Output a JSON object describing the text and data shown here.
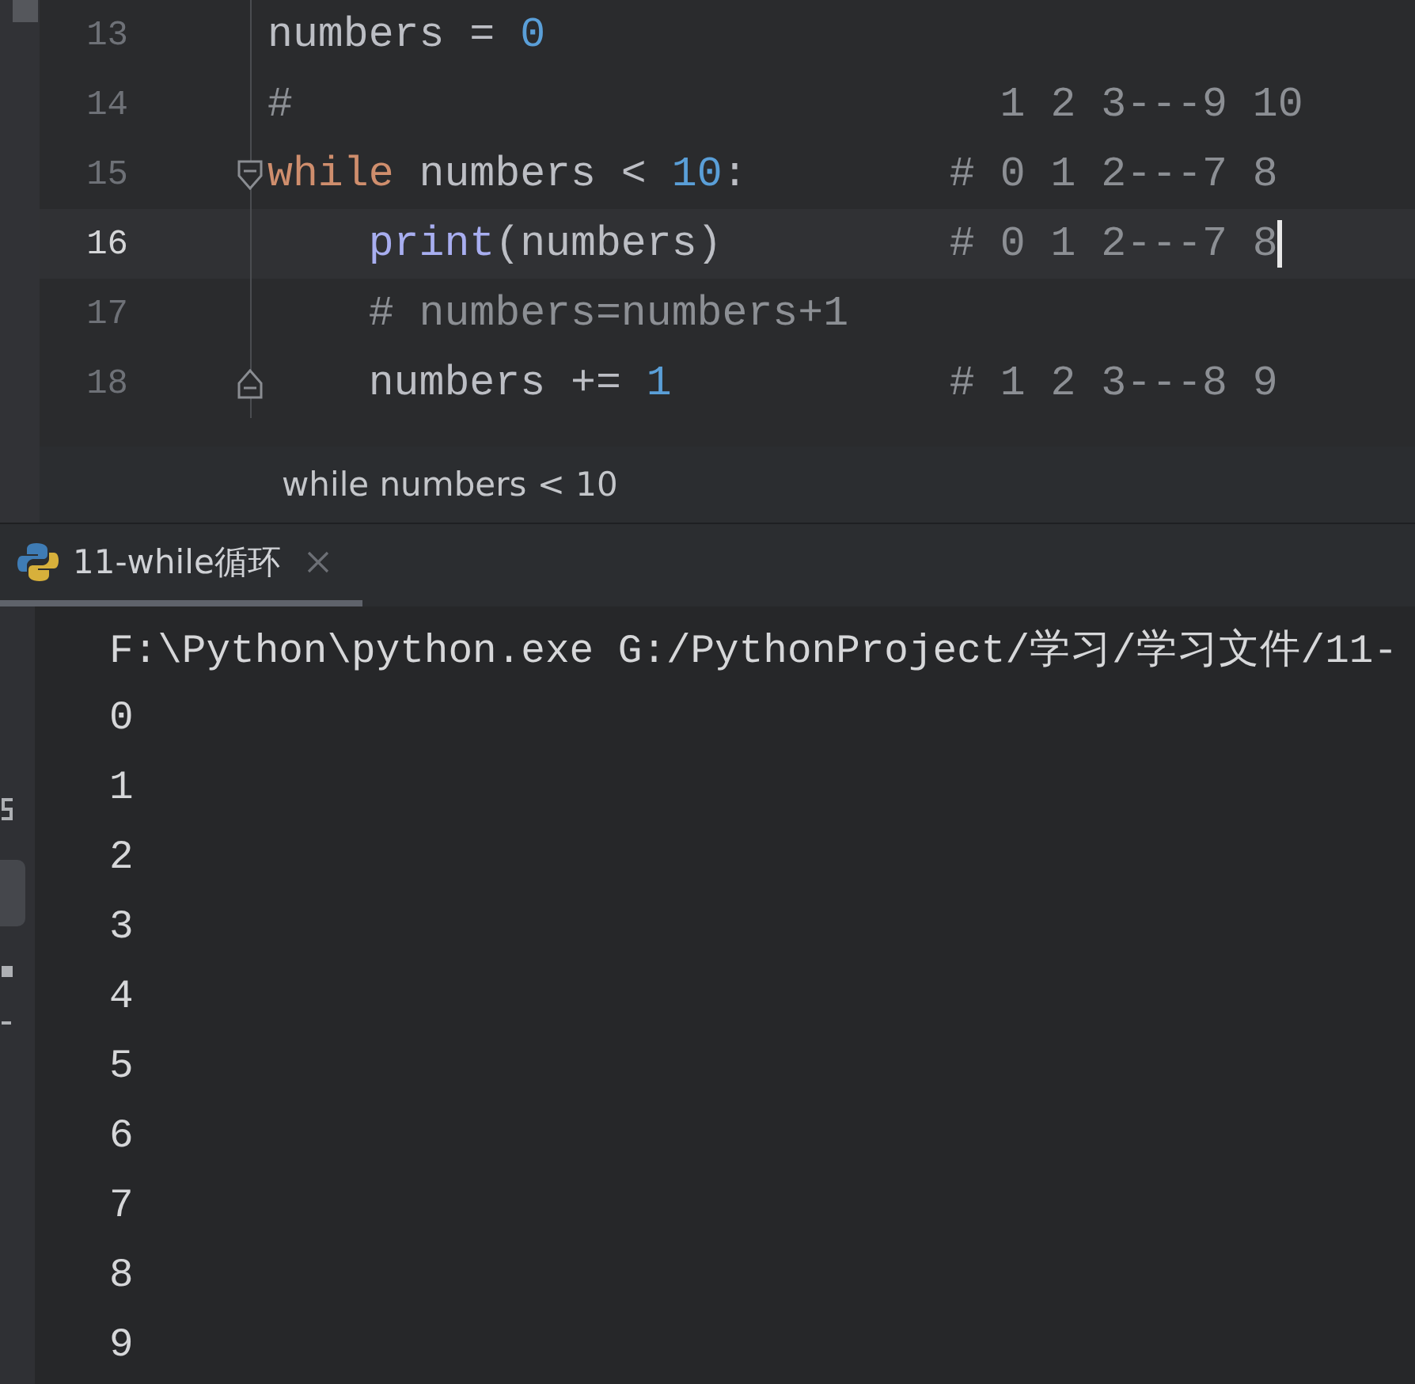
{
  "editor": {
    "lines": [
      {
        "number": "13",
        "kind": "plain",
        "current": false,
        "tokens": [
          {
            "kind": "plain",
            "text": "numbers = "
          },
          {
            "kind": "number",
            "text": "0"
          }
        ]
      },
      {
        "number": "14",
        "kind": "plain",
        "current": false,
        "tokens": [
          {
            "kind": "comment",
            "text": "#                            1 2 3---9 10"
          }
        ]
      },
      {
        "number": "15",
        "kind": "fold-start",
        "current": false,
        "tokens": [
          {
            "kind": "keyword",
            "text": "while"
          },
          {
            "kind": "plain",
            "text": " numbers < "
          },
          {
            "kind": "number",
            "text": "10"
          },
          {
            "kind": "plain",
            "text": ":"
          },
          {
            "kind": "comment",
            "text": "        # 0 1 2---7 8"
          }
        ]
      },
      {
        "number": "16",
        "kind": "plain",
        "current": true,
        "tokens": [
          {
            "kind": "function",
            "text": "    print"
          },
          {
            "kind": "plain",
            "text": "(numbers)"
          },
          {
            "kind": "comment",
            "text": "         # 0 1 2---7 8"
          }
        ]
      },
      {
        "number": "17",
        "kind": "plain",
        "current": false,
        "tokens": [
          {
            "kind": "comment",
            "text": "    # numbers=numbers+1"
          }
        ]
      },
      {
        "number": "18",
        "kind": "fold-end",
        "current": false,
        "tokens": [
          {
            "kind": "plain",
            "text": "    numbers += "
          },
          {
            "kind": "number",
            "text": "1"
          },
          {
            "kind": "comment",
            "text": "           # 1 2 3---8 9"
          }
        ]
      }
    ]
  },
  "breadcrumb": "while numbers < 10",
  "tabs": [
    {
      "label": "11-while循环",
      "selected": true
    }
  ],
  "console": {
    "lines": [
      "F:\\Python\\python.exe G:/PythonProject/学习/学习文件/11-",
      "0",
      "1",
      "2",
      "3",
      "4",
      "5",
      "6",
      "7",
      "8",
      "9"
    ]
  }
}
